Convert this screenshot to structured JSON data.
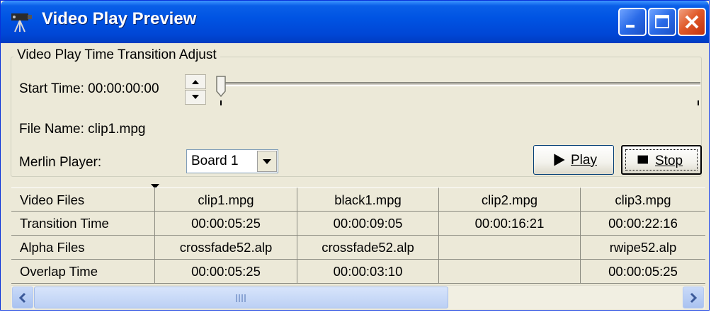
{
  "window": {
    "title": "Video Play Preview",
    "icon": "video-camera-icon",
    "controls": [
      "minimize-icon",
      "maximize-icon",
      "close-icon"
    ],
    "accent_color": "#0054e3",
    "close_color": "#e05a2a"
  },
  "group": {
    "legend": "Video Play Time Transition Adjust",
    "start_time_label": "Start Time:",
    "start_time_value": "00:00:00:00",
    "slider_position": 0,
    "file_name_label": "File Name:",
    "file_name_value": "clip1.mpg",
    "player_label": "Merlin Player:",
    "player_selected": "Board 1",
    "play_label": "Play",
    "stop_label": "Stop"
  },
  "grid": {
    "row_headers": [
      "Video Files",
      "Transition Time",
      "Alpha Files",
      "Overlap Time"
    ],
    "columns": [
      {
        "video": "clip1.mpg",
        "transition": "00:00:05:25",
        "alpha": "crossfade52.alp",
        "overlap": "00:00:05:25"
      },
      {
        "video": "black1.mpg",
        "transition": "00:00:09:05",
        "alpha": "crossfade52.alp",
        "overlap": "00:00:03:10"
      },
      {
        "video": "clip2.mpg",
        "transition": "00:00:16:21",
        "alpha": "",
        "overlap": ""
      },
      {
        "video": "clip3.mpg",
        "transition": "00:00:22:16",
        "alpha": "rwipe52.alp",
        "overlap": "00:00:05:25"
      }
    ]
  }
}
